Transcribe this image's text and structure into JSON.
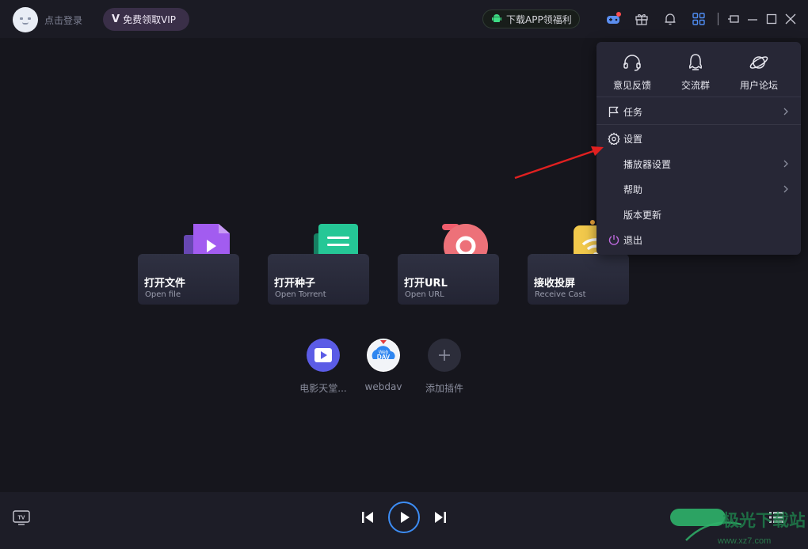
{
  "titlebar": {
    "login_label": "点击登录",
    "vip_badge": "V",
    "vip_label": "免费领取VIP",
    "download_app_label": "下载APP领福利"
  },
  "cards": [
    {
      "title": "打开文件",
      "subtitle": "Open file"
    },
    {
      "title": "打开种子",
      "subtitle": "Open Torrent"
    },
    {
      "title": "打开URL",
      "subtitle": "Open URL"
    },
    {
      "title": "接收投屏",
      "subtitle": "Receive Cast"
    }
  ],
  "plugins": [
    {
      "label": "电影天堂..."
    },
    {
      "label": "webdav",
      "icon_text_top": "Web",
      "icon_text_bottom": "DAV"
    },
    {
      "label": "添加插件"
    }
  ],
  "menu": {
    "top_items": [
      {
        "label": "意见反馈",
        "icon": "headset-icon"
      },
      {
        "label": "交流群",
        "icon": "penguin-icon"
      },
      {
        "label": "用户论坛",
        "icon": "planet-icon"
      }
    ],
    "items": [
      {
        "label": "任务",
        "icon": "flag-icon",
        "has_submenu": true
      },
      {
        "label": "设置",
        "icon": "gear-icon",
        "has_submenu": false
      },
      {
        "label": "播放器设置",
        "has_submenu": true
      },
      {
        "label": "帮助",
        "has_submenu": true
      },
      {
        "label": "版本更新",
        "has_submenu": false
      },
      {
        "label": "退出",
        "icon": "power-icon",
        "has_submenu": false
      }
    ]
  },
  "bottombar": {
    "tv_label": "TV"
  },
  "watermark": {
    "text": "极光下载站",
    "url": "www.xz7.com"
  },
  "colors": {
    "background": "#16161d",
    "menu_bg": "#272736",
    "accent_blue": "#3d8df5",
    "vip_bg": "#3a2f48",
    "arrow_red": "#e02020",
    "notify_dot": "#ff4d4f"
  }
}
